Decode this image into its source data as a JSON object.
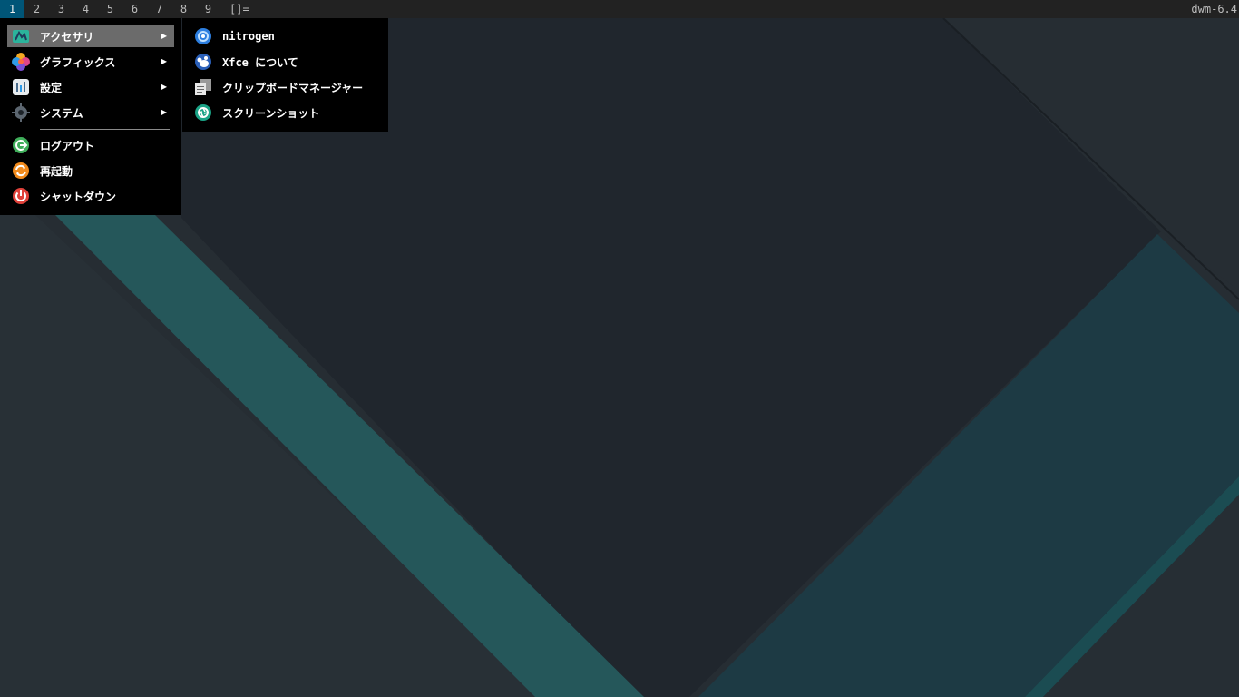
{
  "bar": {
    "tags": [
      "1",
      "2",
      "3",
      "4",
      "5",
      "6",
      "7",
      "8",
      "9"
    ],
    "active_tag": "1",
    "layout_symbol": "[]=",
    "status": "dwm-6.4"
  },
  "menu": {
    "items": [
      {
        "label": "アクセサリ",
        "icon": "accessories-icon",
        "has_submenu": true
      },
      {
        "label": "グラフィックス",
        "icon": "graphics-icon",
        "has_submenu": true
      },
      {
        "label": "設定",
        "icon": "settings-icon",
        "has_submenu": true
      },
      {
        "label": "システム",
        "icon": "system-gear-icon",
        "has_submenu": true
      },
      {
        "label": "ログアウト",
        "icon": "logout-icon",
        "has_submenu": false
      },
      {
        "label": "再起動",
        "icon": "restart-icon",
        "has_submenu": false
      },
      {
        "label": "シャットダウン",
        "icon": "power-icon",
        "has_submenu": false
      }
    ],
    "submenu_arrow": "▶"
  },
  "submenu": {
    "items": [
      {
        "label": "nitrogen",
        "icon": "nitrogen-icon"
      },
      {
        "label": "Xfce について",
        "icon": "xfce-mouse-icon"
      },
      {
        "label": "クリップボードマネージャー",
        "icon": "clipboard-icon"
      },
      {
        "label": "スクリーンショット",
        "icon": "screenshot-icon"
      }
    ]
  },
  "colors": {
    "bar_bg": "#222222",
    "active_tag_bg": "#005577",
    "menu_bg": "#000000",
    "menu_selected": "#6b6b6b",
    "wallpaper_dark": "#222930",
    "wallpaper_teal": "#25575a",
    "wallpaper_teal_dark": "#1d3a44"
  }
}
